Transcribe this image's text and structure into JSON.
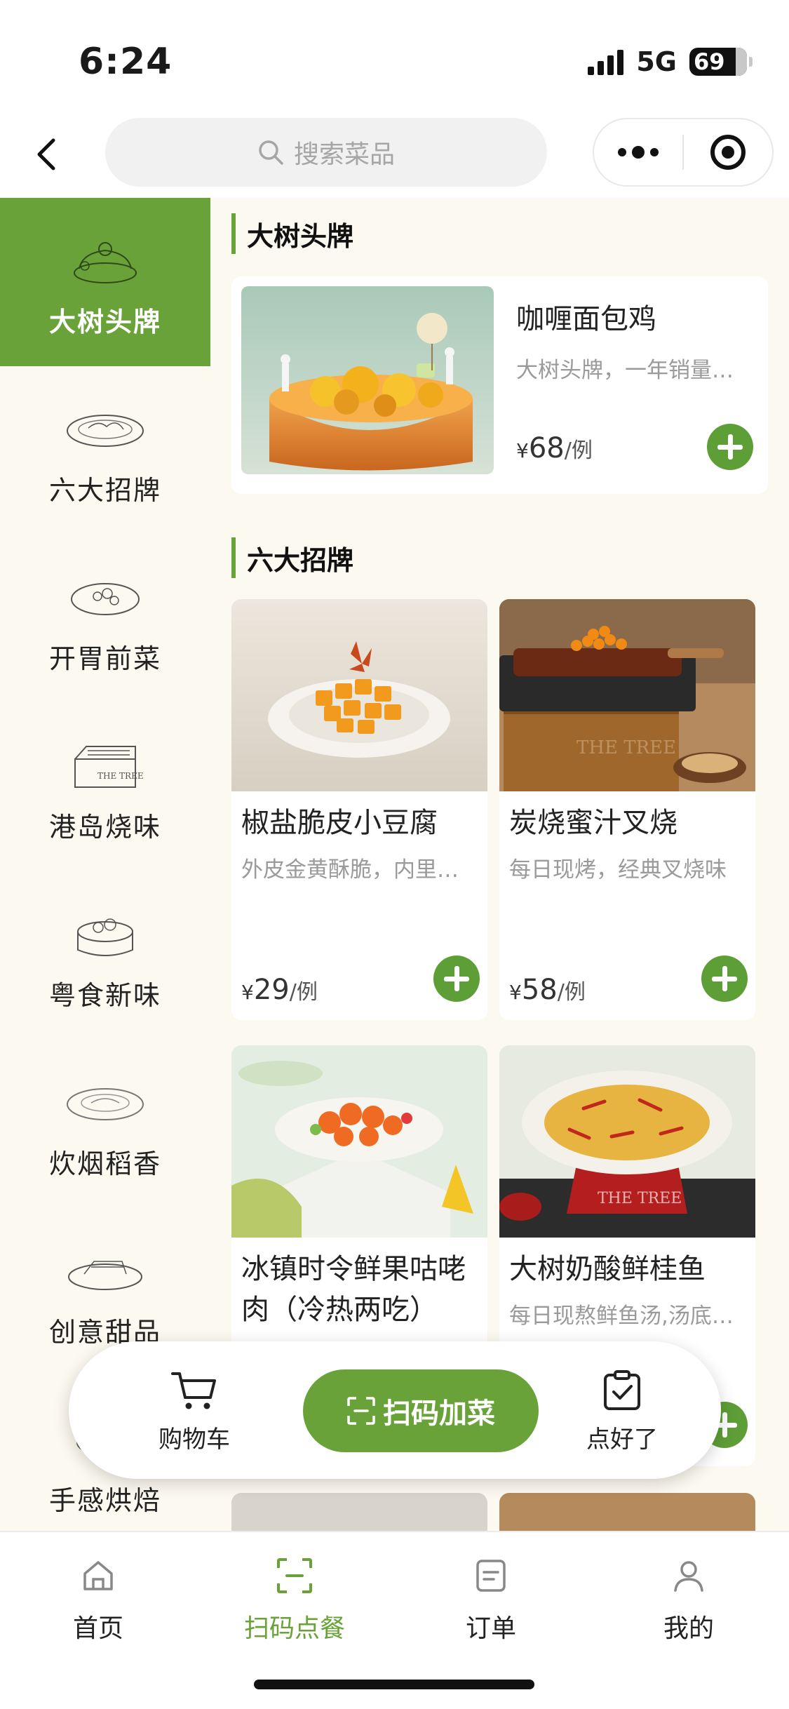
{
  "status_bar": {
    "time": "6:24",
    "network": "5G",
    "battery": "69"
  },
  "navbar": {
    "search_placeholder": "搜索菜品",
    "back_icon": "chevron-left-icon",
    "more_icon": "more-dots-icon",
    "close_icon": "target-circle-icon"
  },
  "sidebar": {
    "active_index": 0,
    "categories": [
      {
        "label": "大树头牌",
        "icon": "bowl-sketch-icon"
      },
      {
        "label": "六大招牌",
        "icon": "plate-sketch-icon"
      },
      {
        "label": "开胃前菜",
        "icon": "bowl-sketch-icon"
      },
      {
        "label": "港岛烧味",
        "icon": "grill-sketch-icon"
      },
      {
        "label": "粤食新味",
        "icon": "pot-sketch-icon"
      },
      {
        "label": "炊烟稻香",
        "icon": "plate-sketch-icon"
      },
      {
        "label": "创意甜品",
        "icon": "dessert-sketch-icon"
      },
      {
        "label": "手感烘焙",
        "icon": "bread-sketch-icon"
      }
    ]
  },
  "sections": [
    {
      "title": "大树头牌",
      "items": [
        {
          "name": "咖喱面包鸡",
          "desc": "大树头牌，一年销量…",
          "currency": "¥",
          "price": "68",
          "unit": "/例"
        }
      ]
    },
    {
      "title": "六大招牌",
      "items": [
        {
          "name": "椒盐脆皮小豆腐",
          "desc": "外皮金黄酥脆，内里…",
          "currency": "¥",
          "price": "29",
          "unit": "/例"
        },
        {
          "name": "炭烧蜜汁叉烧",
          "desc": "每日现烤，经典叉烧味",
          "currency": "¥",
          "price": "58",
          "unit": "/例"
        },
        {
          "name": "冰镇时令鲜果咕咾肉（冷热两吃）",
          "desc": "",
          "currency": "",
          "price": "",
          "unit": ""
        },
        {
          "name": "大树奶酸鲜桂鱼",
          "desc": "每日现熬鲜鱼汤,汤底…",
          "currency": "",
          "price": "",
          "unit": ""
        }
      ]
    }
  ],
  "float_bar": {
    "cart_label": "购物车",
    "scan_label": "扫码加菜",
    "done_label": "点好了"
  },
  "tabbar": {
    "active_index": 1,
    "tabs": [
      {
        "label": "首页",
        "icon": "home-icon"
      },
      {
        "label": "扫码点餐",
        "icon": "scan-icon"
      },
      {
        "label": "订单",
        "icon": "order-list-icon"
      },
      {
        "label": "我的",
        "icon": "user-icon"
      }
    ]
  },
  "colors": {
    "accent": "#6aa23a",
    "add_button": "#5e9e37",
    "content_bg": "#fcf9f0"
  }
}
